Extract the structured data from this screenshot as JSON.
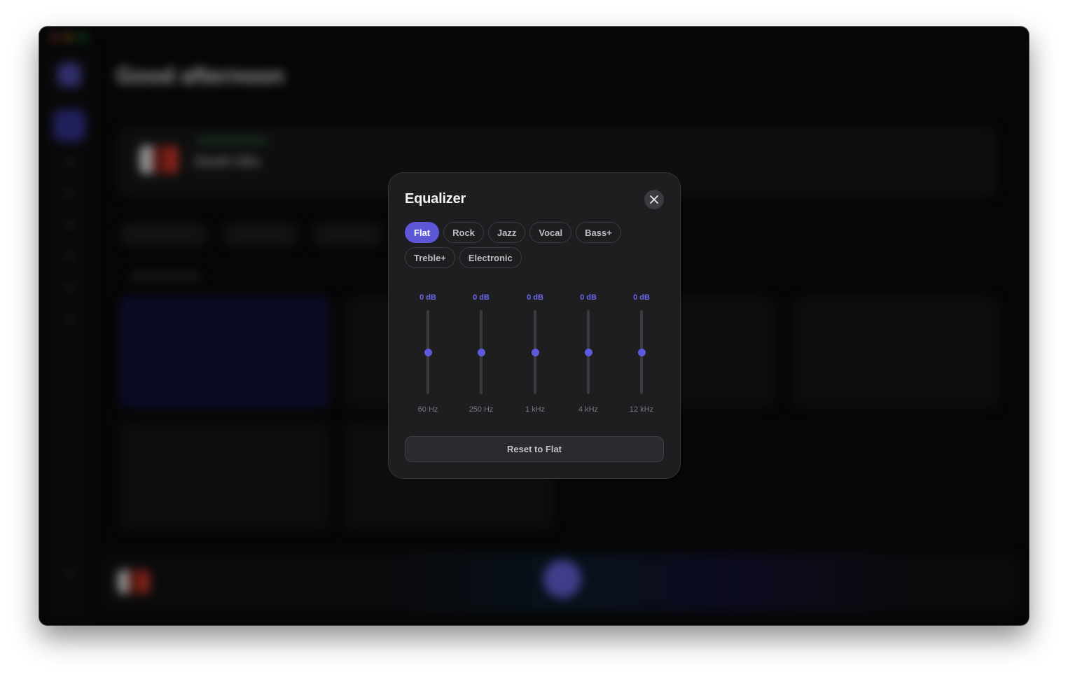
{
  "background": {
    "greeting": "Good afternoon",
    "now_playing_title": "Death Hits"
  },
  "equalizer": {
    "title": "Equalizer",
    "presets": [
      {
        "label": "Flat",
        "active": true
      },
      {
        "label": "Rock",
        "active": false
      },
      {
        "label": "Jazz",
        "active": false
      },
      {
        "label": "Vocal",
        "active": false
      },
      {
        "label": "Bass+",
        "active": false
      },
      {
        "label": "Treble+",
        "active": false
      },
      {
        "label": "Electronic",
        "active": false
      }
    ],
    "bands": [
      {
        "value_label": "0 dB",
        "frequency": "60 Hz",
        "gain_fraction": 0.5
      },
      {
        "value_label": "0 dB",
        "frequency": "250 Hz",
        "gain_fraction": 0.5
      },
      {
        "value_label": "0 dB",
        "frequency": "1 kHz",
        "gain_fraction": 0.5
      },
      {
        "value_label": "0 dB",
        "frequency": "4 kHz",
        "gain_fraction": 0.5
      },
      {
        "value_label": "0 dB",
        "frequency": "12 kHz",
        "gain_fraction": 0.5
      }
    ],
    "reset_label": "Reset to Flat"
  },
  "colors": {
    "accent": "#5b57d6",
    "value_text": "#6b67e8"
  }
}
